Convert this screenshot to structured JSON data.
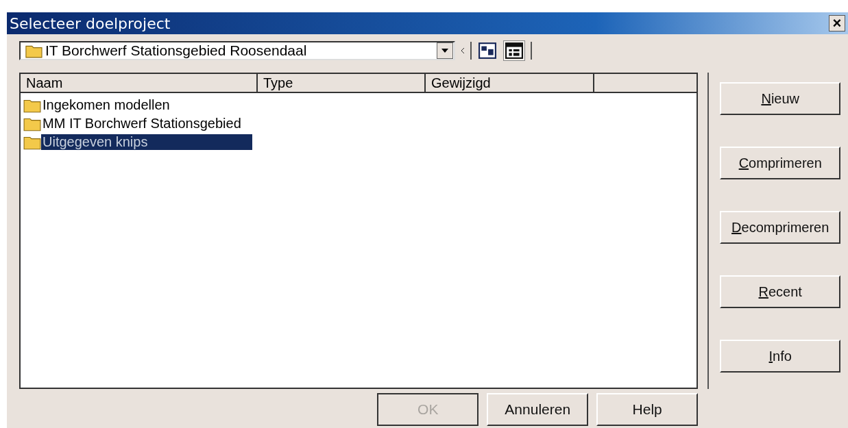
{
  "window": {
    "title": "Selecteer doelproject",
    "close": "×"
  },
  "location": {
    "value": "IT Borchwerf Stationsgebied Roosendaal"
  },
  "table": {
    "columns": [
      "Naam",
      "Type",
      "Gewijzigd"
    ],
    "rows": [
      {
        "name": "Ingekomen modellen",
        "selected": false
      },
      {
        "name": "MM IT Borchwerf Stationsgebied",
        "selected": false
      },
      {
        "name": "Uitgegeven knips",
        "selected": true
      }
    ]
  },
  "side_buttons": [
    "Nieuw",
    "Comprimeren",
    "Decomprimeren",
    "Recent",
    "Info"
  ],
  "buttons": [
    {
      "label": "OK",
      "disabled": true
    },
    {
      "label": "Annuleren",
      "disabled": false
    },
    {
      "label": "Help",
      "disabled": false
    }
  ]
}
